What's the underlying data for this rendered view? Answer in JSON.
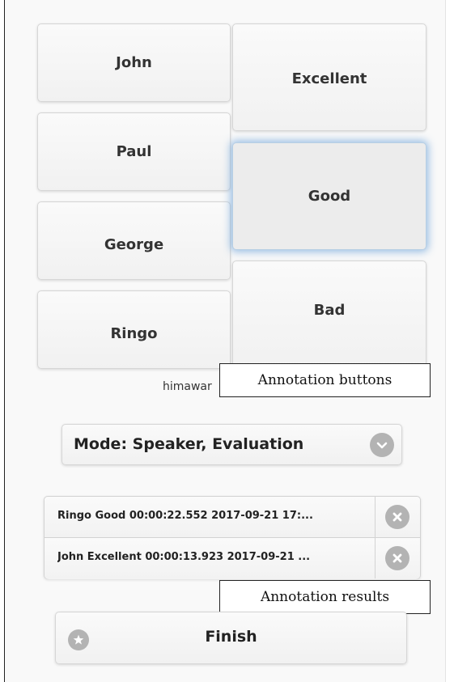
{
  "speakers": [
    {
      "label": "John"
    },
    {
      "label": "Paul"
    },
    {
      "label": "George"
    },
    {
      "label": "Ringo"
    }
  ],
  "evaluations": [
    {
      "label": "Excellent",
      "selected": false
    },
    {
      "label": "Good",
      "selected": true
    },
    {
      "label": "Bad",
      "selected": false
    }
  ],
  "footer_text": "himawar",
  "mode_select": {
    "value": "Mode: Speaker, Evaluation",
    "icon": "chevron-down-icon"
  },
  "results": [
    {
      "text": "Ringo Good 00:00:22.552 2017-09-21 17:...",
      "delete_icon": "close-circle-icon"
    },
    {
      "text": "John Excellent 00:00:13.923 2017-09-21 ...",
      "delete_icon": "close-circle-icon"
    }
  ],
  "finish": {
    "label": "Finish",
    "icon": "star-icon"
  },
  "callouts": {
    "buttons": "Annotation buttons",
    "results": "Annotation results"
  },
  "colors": {
    "selection_glow": "#78aadc",
    "icon_gray": "#b3b3b3"
  }
}
